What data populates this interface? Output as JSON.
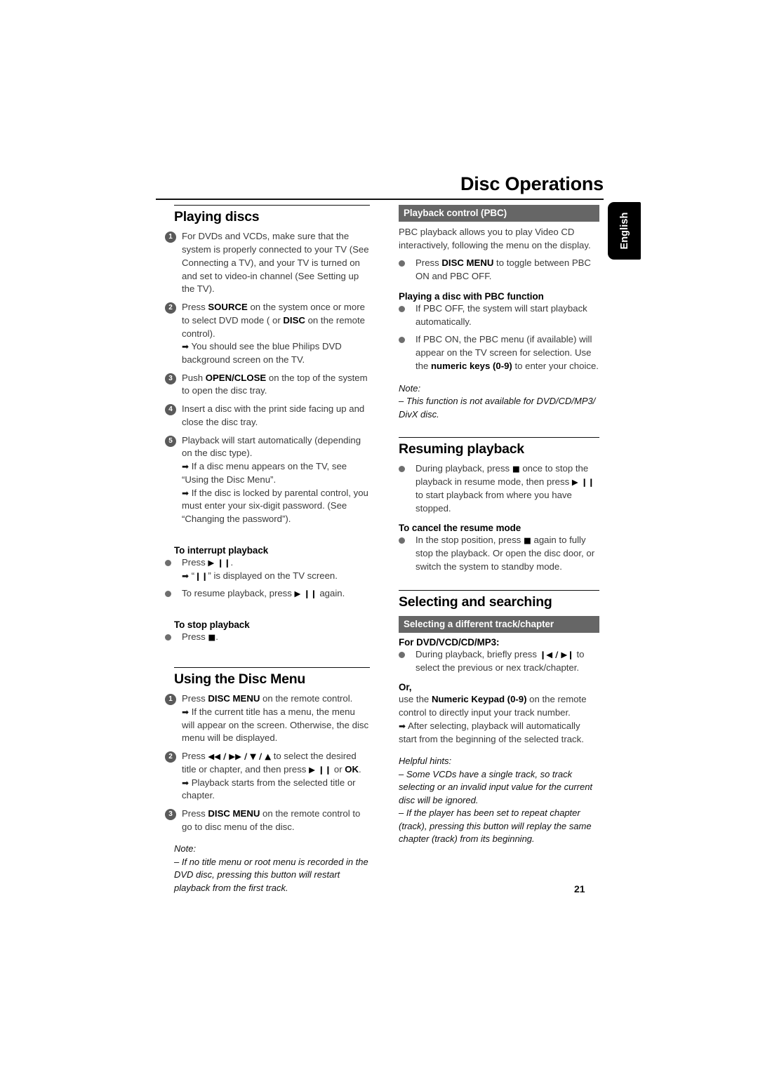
{
  "page": {
    "chapter_title": "Disc Operations",
    "language_tab": "English",
    "page_number": "21"
  },
  "left_column": {
    "section1": {
      "title": "Playing discs",
      "steps": [
        {
          "num": "1",
          "text": "For DVDs and VCDs, make sure that the system is properly connected to your TV (See Connecting a TV), and your TV is turned on and set to video-in channel (See Setting up the TV)."
        },
        {
          "num": "2",
          "text_pre": "Press ",
          "bold1": "SOURCE",
          "text_mid": " on the system once or more to select DVD mode ( or ",
          "bold2": "DISC",
          "text_post": " on the remote control).",
          "arrow1": "You should see the blue Philips DVD background screen on the TV."
        },
        {
          "num": "3",
          "text_pre": "Push ",
          "bold1": "OPEN/CLOSE",
          "text_post": " on the top of the system to open the disc tray."
        },
        {
          "num": "4",
          "text": "Insert a disc with the print side facing up and close the disc tray."
        },
        {
          "num": "5",
          "text": "Playback will start automatically (depending on the disc type).",
          "arrow1": "If a disc menu appears on the TV, see “Using the Disc Menu”.",
          "arrow2": "If the disc is locked by parental control, you must enter your six-digit password. (See “Changing the password”)."
        }
      ],
      "interrupt_heading": "To interrupt playback",
      "interrupt_press": "Press",
      "interrupt_glyph": "▶ ❙❙",
      "interrupt_period": ".",
      "interrupt_arrow_pre": "“",
      "interrupt_arrow_glyph": "❙❙",
      "interrupt_arrow_post": "” is displayed on the TV screen.",
      "resume_pre": "To resume playback, press",
      "resume_glyph": "▶ ❙❙",
      "resume_post": "again.",
      "stop_heading": "To stop playback",
      "stop_press": "Press",
      "stop_glyph": "■",
      "stop_period": "."
    },
    "section2": {
      "title": "Using the Disc Menu",
      "steps": [
        {
          "num": "1",
          "text_pre": "Press ",
          "bold1": "DISC MENU",
          "text_post": " on the remote control.",
          "arrow1": "If the current title has a menu, the menu will appear on the screen.  Otherwise, the disc menu will be displayed."
        },
        {
          "num": "2",
          "text_pre": "Press ",
          "glyph1": "◀◀ / ▶▶ / ▼ / ▲",
          "text_mid": " to select the desired title or chapter, and then press ",
          "glyph2": "▶ ❙❙",
          "text_mid2": " or ",
          "bold2": "OK",
          "text_post": ".",
          "arrow1": "Playback starts from the selected title or chapter."
        },
        {
          "num": "3",
          "text_pre": "Press ",
          "bold1": "DISC MENU",
          "text_post": " on the remote control to go to disc menu of the disc."
        }
      ],
      "note_title": "Note:",
      "note_items": [
        "–  If no title menu or root menu is recorded in the DVD disc, pressing this button will restart playback from the first track."
      ]
    }
  },
  "right_column": {
    "pbc": {
      "banner": "Playback  control (PBC)",
      "intro": "PBC playback allows you to play Video CD interactively, following the menu on the display.",
      "bullet1_pre": "Press ",
      "bullet1_bold": "DISC MENU",
      "bullet1_post": " to toggle between PBC ON and PBC OFF.",
      "subhead": "Playing a disc with PBC function",
      "bullet2": "If PBC OFF, the system will start playback automatically.",
      "bullet3_pre": "If PBC ON, the PBC menu (if available) will appear on the TV screen for selection. Use the ",
      "bullet3_bold": "numeric keys (0-9)",
      "bullet3_post": " to enter your choice.",
      "note_title": "Note:",
      "note_items": [
        "–  This function is not available for DVD/CD/MP3/ DivX disc."
      ]
    },
    "resuming": {
      "title": "Resuming playback",
      "bullet1_pre": "During playback, press ",
      "bullet1_glyph1": "■",
      "bullet1_mid": " once to stop the playback in resume mode, then press ",
      "bullet1_glyph2": "▶ ❙❙",
      "bullet1_post": " to start playback from where you have stopped.",
      "subhead": "To cancel the resume mode",
      "bullet2_pre": "In the stop position, press ",
      "bullet2_glyph": "■",
      "bullet2_post": " again to fully stop the playback. Or open the disc door, or switch the system to standby mode."
    },
    "selecting": {
      "title": "Selecting and searching",
      "banner": "Selecting a different track/chapter",
      "subhead": "For DVD/VCD/CD/MP3:",
      "bullet1_pre": "During playback, briefly press ",
      "bullet1_glyph": "❙◀ / ▶❙",
      "bullet1_post": " to select the previous or nex track/chapter.",
      "or_label": "Or,",
      "or_pre": "use the ",
      "or_bold": "Numeric Keypad (0-9)",
      "or_post": " on the remote control to directly input your track number.",
      "or_arrow": "After selecting, playback will automatically start from the beginning of the selected track.",
      "hints_title": "Helpful hints:",
      "hints": [
        "–  Some VCDs have a single track,  so track selecting or an invalid input value for the current disc will be ignored.",
        "–   If the player has been set to repeat chapter (track), pressing this button will replay the same chapter (track) from its beginning."
      ]
    }
  }
}
